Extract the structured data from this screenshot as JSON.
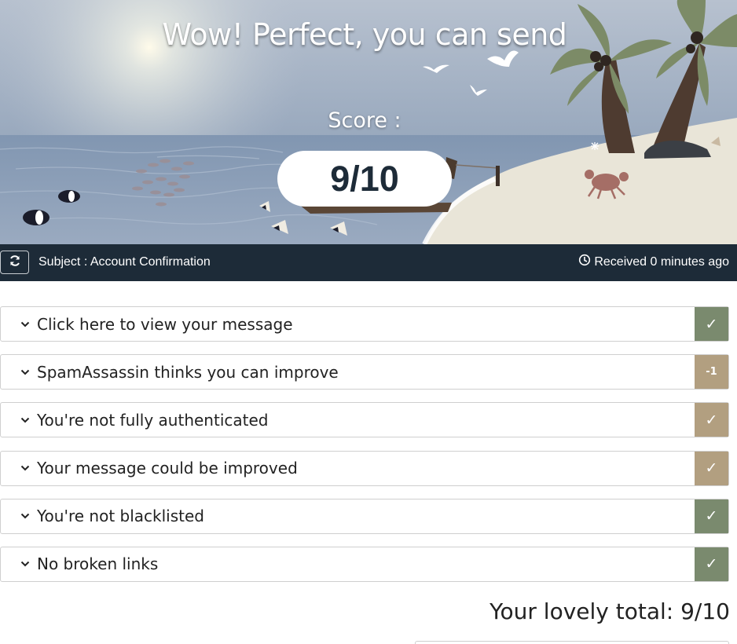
{
  "hero": {
    "title": "Wow! Perfect, you can send",
    "score_label": "Score :",
    "score_value": "9/10"
  },
  "subject_bar": {
    "subject": "Subject : Account Confirmation",
    "received": "Received 0 minutes ago",
    "icons": [
      "refresh-icon",
      "clock-icon"
    ]
  },
  "checks": [
    {
      "label": "Click here to view your message",
      "badge": "✓",
      "status": "pass",
      "color": "#7a8a6e"
    },
    {
      "label": "SpamAssassin thinks you can improve",
      "badge": "-1",
      "status": "penalty",
      "color": "#b29f80"
    },
    {
      "label": "You're not fully authenticated",
      "badge": "✓",
      "status": "warning",
      "color": "#b29f80"
    },
    {
      "label": "Your message could be improved",
      "badge": "✓",
      "status": "warning",
      "color": "#b29f80"
    },
    {
      "label": "You're not blacklisted",
      "badge": "✓",
      "status": "pass",
      "color": "#7a8a6e"
    },
    {
      "label": "No broken links",
      "badge": "✓",
      "status": "pass",
      "color": "#7a8a6e"
    }
  ],
  "total": "Your lovely total: 9/10",
  "colors": {
    "sky": "#9eadc2",
    "sea": "#7e93ae",
    "sand": "#e9e5d8",
    "subject_bar": "#1d2b38",
    "pass": "#7a8a6e",
    "warning": "#b29f80"
  }
}
